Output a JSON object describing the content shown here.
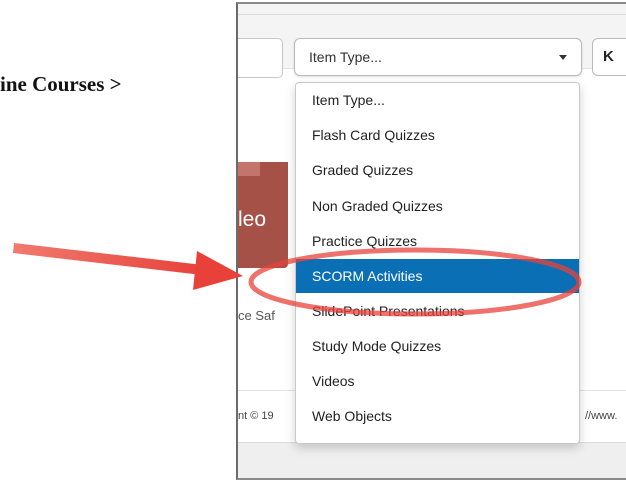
{
  "document": {
    "heading": "ine Courses >"
  },
  "toolbar": {
    "item_type_select": "Item Type...",
    "next_button": "K"
  },
  "dropdown": {
    "items": [
      {
        "label": "Item Type..."
      },
      {
        "label": "Flash Card Quizzes"
      },
      {
        "label": "Graded Quizzes"
      },
      {
        "label": "Non Graded Quizzes"
      },
      {
        "label": "Practice Quizzes"
      },
      {
        "label": "SCORM Activities",
        "selected": true
      },
      {
        "label": "SlidePoint Presentations"
      },
      {
        "label": "Study Mode Quizzes"
      },
      {
        "label": "Videos"
      },
      {
        "label": "Web Objects"
      }
    ]
  },
  "content": {
    "thumbnail_text": "leo",
    "course_name": "ce Saf"
  },
  "footer": {
    "copyright": "nt © 19",
    "url": "//www."
  },
  "colors": {
    "selected_bg": "#0b6fb5",
    "annotation": "#e8413a"
  }
}
